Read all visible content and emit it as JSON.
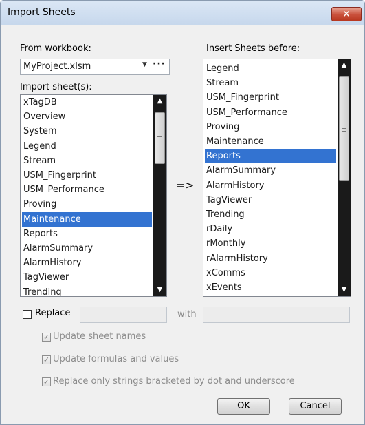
{
  "window": {
    "title": "Import Sheets",
    "close_glyph": "✕"
  },
  "from_workbook": {
    "label": "From workbook:",
    "value": "MyProject.xlsm",
    "dropdown_glyph": "▼",
    "browse_label": "···"
  },
  "import_sheets": {
    "label": "Import sheet(s):",
    "items": [
      "xTagDB",
      "Overview",
      "System",
      "Legend",
      "Stream",
      "USM_Fingerprint",
      "USM_Performance",
      "Proving",
      "Maintenance",
      "Reports",
      "AlarmSummary",
      "AlarmHistory",
      "TagViewer",
      "Trending"
    ],
    "selected": "Maintenance"
  },
  "insert_before": {
    "label": "Insert Sheets before:",
    "items": [
      "Legend",
      "Stream",
      "USM_Fingerprint",
      "USM_Performance",
      "Proving",
      "Maintenance",
      "Reports",
      "AlarmSummary",
      "AlarmHistory",
      "TagViewer",
      "Trending",
      "rDaily",
      "rMonthly",
      "rAlarmHistory",
      "xComms",
      "xEvents"
    ],
    "selected": "Reports"
  },
  "transfer_symbol": "=>",
  "scroll_glyphs": {
    "up": "▲",
    "down": "▼"
  },
  "replace": {
    "label": "Replace",
    "checked": false,
    "find_value": "",
    "with_label": "with",
    "replace_value": ""
  },
  "options": {
    "check_glyph": "✓",
    "update_sheet_names": {
      "label": "Update sheet names",
      "checked": true,
      "enabled": false
    },
    "update_formulas": {
      "label": "Update formulas and values",
      "checked": true,
      "enabled": false
    },
    "replace_bracketed": {
      "label": "Replace only strings bracketed by dot and underscore",
      "checked": true,
      "enabled": false
    }
  },
  "buttons": {
    "ok": "OK",
    "cancel": "Cancel"
  },
  "colors": {
    "selection": "#3373d1",
    "scrollbar": "#1a1a1a",
    "close_button": "#c9503b"
  }
}
